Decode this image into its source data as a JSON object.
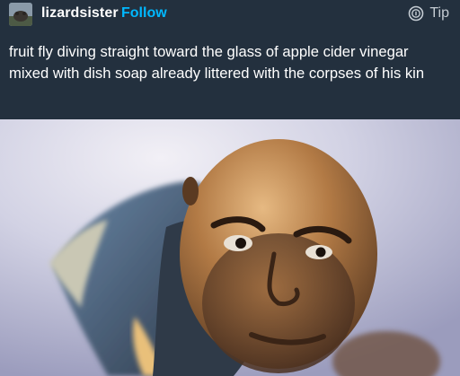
{
  "post": {
    "username": "lizardsister",
    "follow_label": "Follow",
    "tip_label": "Tip",
    "caption": "fruit fly diving straight toward the glass of apple cider vinegar mixed with dish soap already littered with the corpses of his kin"
  },
  "icons": {
    "avatar": "avatar-image",
    "tip": "tip-coin-icon"
  },
  "colors": {
    "background": "#23303e",
    "follow": "#00b8ff",
    "text": "#ffffff"
  }
}
